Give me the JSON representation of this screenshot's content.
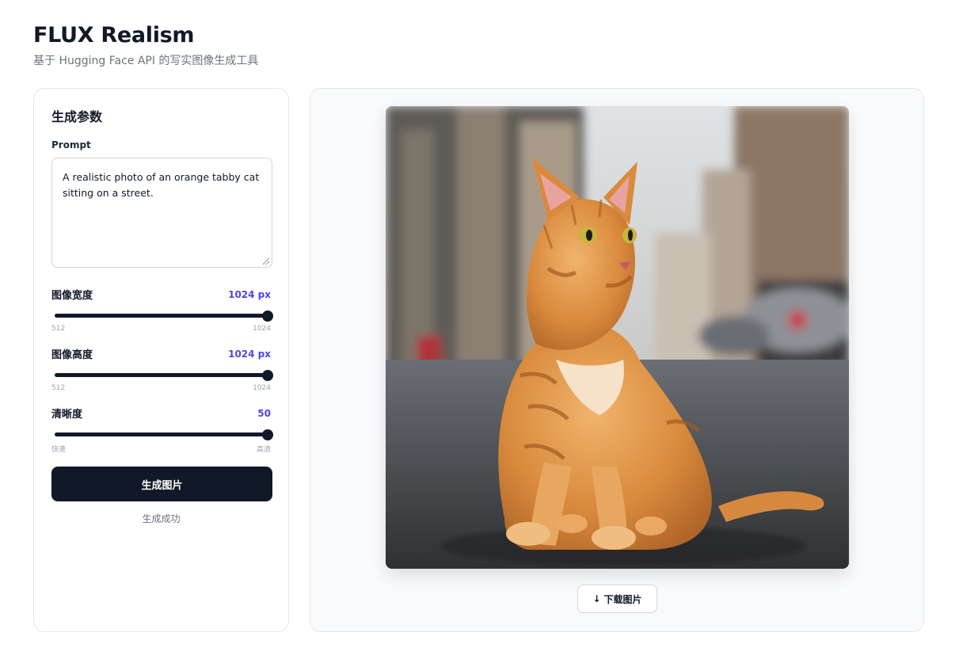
{
  "header": {
    "title": "FLUX Realism",
    "subtitle": "基于 Hugging Face API 的写实图像生成工具"
  },
  "params": {
    "title": "生成参数",
    "prompt_label": "Prompt",
    "prompt_value": "A realistic photo of an orange tabby cat sitting on a street.",
    "width": {
      "label": "图像宽度",
      "value": "1024 px",
      "min_label": "512",
      "max_label": "1024",
      "fraction": 1.0
    },
    "height": {
      "label": "图像高度",
      "value": "1024 px",
      "min_label": "512",
      "max_label": "1024",
      "fraction": 1.0
    },
    "clarity": {
      "label": "清晰度",
      "value": "50",
      "min_label": "快速",
      "max_label": "高清",
      "fraction": 1.0
    },
    "generate_label": "生成图片",
    "status": "生成成功"
  },
  "result": {
    "image_icon": "generated-cat-image",
    "download_icon": "download-arrow-icon",
    "download_arrow": "↓",
    "download_label": "下载图片"
  },
  "colors": {
    "primary": "#111827",
    "accent": "#4f46e5",
    "border": "#e5e7eb"
  }
}
